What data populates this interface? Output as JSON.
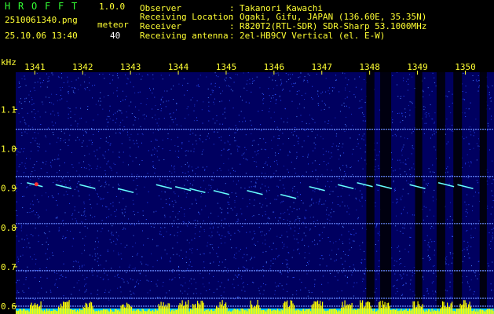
{
  "app": {
    "title_letters": [
      "H",
      "R",
      "O",
      "F",
      "F",
      "T"
    ],
    "version": "1.0.0",
    "filename": "2510061340.png",
    "datetime": "25.10.06 13:40",
    "meteor_label": "meteor",
    "meteor_count": "40"
  },
  "info": {
    "rows": [
      {
        "key": "Observer",
        "sep": ":",
        "value": "Takanori Kawachi"
      },
      {
        "key": "Receiving Location",
        "sep": ":",
        "value": "Ogaki, Gifu, JAPAN (136.60E, 35.35N)"
      },
      {
        "key": "Receiver",
        "sep": ":",
        "value": "R820T2(RTL-SDR) SDR-Sharp 53.1000MHz"
      },
      {
        "key": "Receiving antenna",
        "sep": ":",
        "value": "2el-HB9CV Vertical (el. E-W)"
      }
    ]
  },
  "axis": {
    "y_unit": "kHz",
    "time_ticks": [
      "1341",
      "1342",
      "1343",
      "1344",
      "1345",
      "1346",
      "1347",
      "1348",
      "1349",
      "1350"
    ],
    "freq_ticks": [
      "1.1",
      "1.0",
      "0.9",
      "0.8",
      "0.7",
      "0.6"
    ]
  },
  "colors": {
    "background": "#000000",
    "waterfall": "#000060",
    "label_yellow": "#ffff33",
    "label_green": "#33ff33",
    "meteor_cyan": "#66ffff",
    "amplitude_yellow": "#ffff00",
    "baseline_cyan": "#00ccff"
  },
  "chart_data": {
    "type": "heatmap",
    "xlabel": "",
    "ylabel": "kHz",
    "x_ticks": [
      1341,
      1342,
      1343,
      1344,
      1345,
      1346,
      1347,
      1348,
      1349,
      1350
    ],
    "xlim": [
      1340.6,
      1350.6
    ],
    "ylim": [
      0.58,
      1.195
    ],
    "y_ticks": [
      1.1,
      1.0,
      0.9,
      0.8,
      0.7,
      0.6
    ],
    "carrier_lines_khz": [
      1.05,
      0.93,
      0.81,
      0.69,
      0.62,
      0.6
    ],
    "meteor_pings": [
      {
        "t": 1341.0,
        "f": 0.91
      },
      {
        "t": 1341.6,
        "f": 0.905
      },
      {
        "t": 1342.1,
        "f": 0.905
      },
      {
        "t": 1342.9,
        "f": 0.895
      },
      {
        "t": 1343.7,
        "f": 0.905
      },
      {
        "t": 1344.1,
        "f": 0.9
      },
      {
        "t": 1344.4,
        "f": 0.895
      },
      {
        "t": 1344.9,
        "f": 0.89
      },
      {
        "t": 1345.6,
        "f": 0.89
      },
      {
        "t": 1346.3,
        "f": 0.88
      },
      {
        "t": 1346.9,
        "f": 0.9
      },
      {
        "t": 1347.5,
        "f": 0.905
      },
      {
        "t": 1347.9,
        "f": 0.91
      },
      {
        "t": 1348.3,
        "f": 0.905
      },
      {
        "t": 1349.0,
        "f": 0.905
      },
      {
        "t": 1349.6,
        "f": 0.91
      },
      {
        "t": 1350.0,
        "f": 0.905
      }
    ],
    "dark_bands_min": [
      [
        1347.93,
        1348.1
      ],
      [
        1348.22,
        1348.45
      ],
      [
        1348.95,
        1349.1
      ],
      [
        1349.4,
        1349.58
      ],
      [
        1349.75,
        1349.93
      ],
      [
        1350.3,
        1350.45
      ]
    ]
  }
}
